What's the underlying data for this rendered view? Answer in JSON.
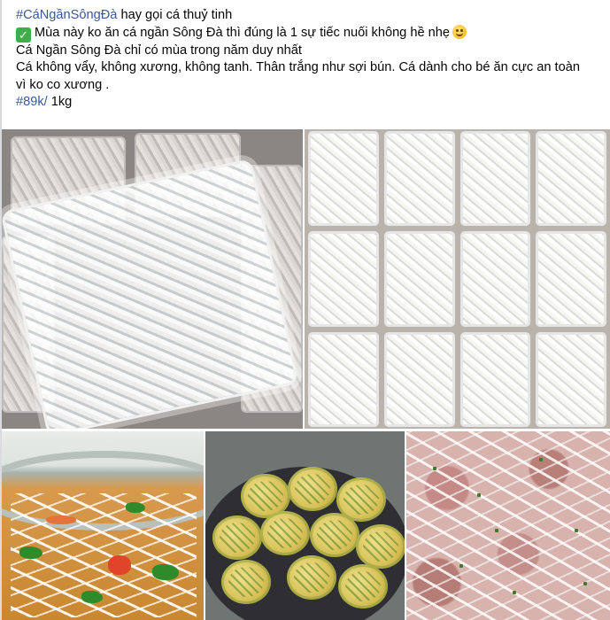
{
  "post": {
    "lines": [
      {
        "hashtag": "#CáNgầnSôngĐà",
        "text": " hay gọi cá thuỷ tinh"
      },
      {
        "text": "Mùa này ko ăn cá ngần Sông Đà thì đúng là 1 sự tiếc nuối không hề nhẹ"
      },
      {
        "text": "Cá Ngần Sông Đà  chỉ có mùa trong năm duy nhất"
      },
      {
        "text": "Cá không vẩy, không xương, không tanh. Thân trắng như sợi bún. Cá dành cho bé ăn cực an toàn"
      },
      {
        "text": "vì ko co xương ."
      },
      {
        "hashtag": "#89k/",
        "text": " 1kg"
      }
    ],
    "icons": {
      "check": "check-mark-icon",
      "emoji": "grinning-sweat-emoji-icon"
    },
    "colors": {
      "hashtag": "#385898",
      "check_bg": "#3fae49"
    }
  },
  "photos": [
    {
      "name": "glass-fish-tray-closeup-photo"
    },
    {
      "name": "glass-fish-trays-grid-photo"
    },
    {
      "name": "fish-noodle-soup-photo"
    },
    {
      "name": "fish-patties-pan-photo"
    },
    {
      "name": "fish-meat-mix-photo"
    }
  ]
}
